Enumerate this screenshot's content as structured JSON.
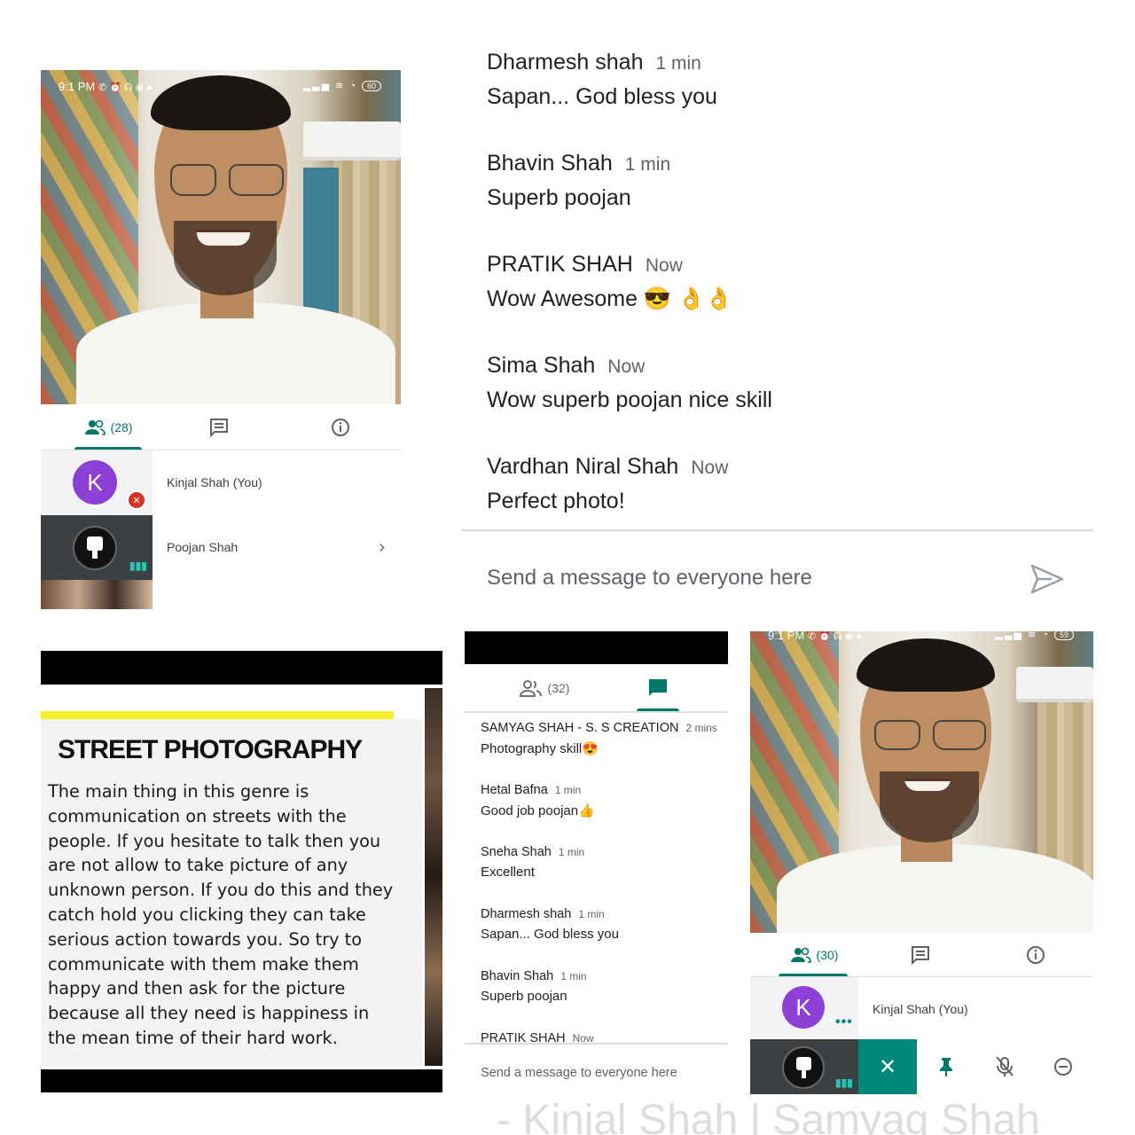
{
  "top_left_call": {
    "status_time": "9:1",
    "status_time_suffix": "PM",
    "battery": "60",
    "participants_count": "(28)",
    "participants": [
      {
        "initial": "K",
        "name": "Kinjal Shah (You)"
      },
      {
        "name": "Poojan Shah"
      }
    ]
  },
  "large_chat": {
    "messages": [
      {
        "sender": "Dharmesh shah",
        "time": "1 min",
        "text": "Sapan... God bless you"
      },
      {
        "sender": "Bhavin Shah",
        "time": "1 min",
        "text": "Superb poojan"
      },
      {
        "sender": "PRATIK SHAH",
        "time": "Now",
        "text": "Wow Awesome 😎 👌👌"
      },
      {
        "sender": "Sima Shah",
        "time": "Now",
        "text": "Wow superb poojan nice skill"
      },
      {
        "sender": "Vardhan Niral Shah",
        "time": "Now",
        "text": "Perfect photo!"
      }
    ],
    "input_placeholder": "Send a message to everyone here"
  },
  "slide": {
    "title": "STREET PHOTOGRAPHY",
    "body_lines": [
      "The main thing in this genre is",
      "communication on streets with the",
      "people. If you hesitate to talk then you",
      "are not allow to take picture of any",
      "unknown person. If you do this and they",
      "catch hold you clicking they can take",
      "serious action towards you. So try to",
      "communicate with them make them",
      "happy and then ask for the picture",
      "because all they need is happiness in",
      "the mean time of their hard work."
    ]
  },
  "small_chat": {
    "participants_count": "(32)",
    "messages": [
      {
        "sender": "SAMYAG SHAH - S. S CREATION",
        "time": "2 mins",
        "text": "Photography skill😍"
      },
      {
        "sender": "Hetal Bafna",
        "time": "1 min",
        "text": "Good job poojan👍"
      },
      {
        "sender": "Sneha Shah",
        "time": "1 min",
        "text": "Excellent"
      },
      {
        "sender": "Dharmesh shah",
        "time": "1 min",
        "text": "Sapan... God bless you"
      },
      {
        "sender": "Bhavin Shah",
        "time": "1 min",
        "text": "Superb poojan"
      },
      {
        "sender": "PRATIK SHAH",
        "time": "Now",
        "text": ""
      }
    ],
    "input_placeholder": "Send a message to everyone here"
  },
  "bottom_right_call": {
    "status_time": "9:1",
    "status_time_suffix": "PM",
    "battery": "59",
    "participants_count": "(30)",
    "participants": [
      {
        "initial": "K",
        "name": "Kinjal Shah (You)"
      }
    ]
  },
  "watermark": "- Kinjal Shah | Samyag Shah",
  "colors": {
    "accent": "#00796b",
    "avatar": "#8e3fd6",
    "mute_red": "#d93025",
    "slide_highlight": "#f4f02a"
  }
}
